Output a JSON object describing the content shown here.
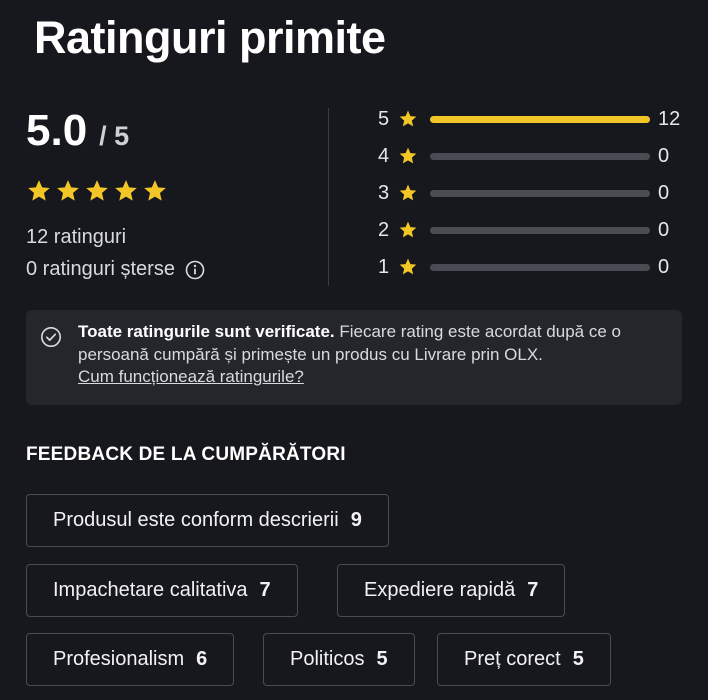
{
  "page": {
    "title": "Ratinguri primite"
  },
  "summary": {
    "score": "5.0",
    "score_max": "/ 5",
    "star_count": 5,
    "ratings_count_text": "12 ratinguri",
    "deleted_text": "0 ratinguri șterse"
  },
  "distribution": [
    {
      "stars": "5",
      "count": "12",
      "fraction": 1.0
    },
    {
      "stars": "4",
      "count": "0",
      "fraction": 0
    },
    {
      "stars": "3",
      "count": "0",
      "fraction": 0
    },
    {
      "stars": "2",
      "count": "0",
      "fraction": 0
    },
    {
      "stars": "1",
      "count": "0",
      "fraction": 0
    }
  ],
  "notice": {
    "bold": "Toate ratingurile sunt verificate.",
    "text": " Fiecare rating este acordat după ce o persoană cumpără și primește un produs cu Livrare prin OLX.",
    "link": "Cum funcționează ratingurile?"
  },
  "feedback": {
    "heading": "FEEDBACK DE LA CUMPĂRĂTORI",
    "chips": [
      {
        "label": "Produsul este conform descrierii",
        "count": "9"
      },
      {
        "label": "Impachetare calitativa",
        "count": "7"
      },
      {
        "label": "Expediere rapidă",
        "count": "7"
      },
      {
        "label": "Profesionalism",
        "count": "6"
      },
      {
        "label": "Politicos",
        "count": "5"
      },
      {
        "label": "Preț corect",
        "count": "5"
      }
    ]
  },
  "colors": {
    "background": "#17181d",
    "accent_star": "#f3c628",
    "track": "#4a4c53"
  },
  "icons": {
    "star": "star-icon",
    "info": "info-circle-icon",
    "check": "check-circle-icon"
  }
}
